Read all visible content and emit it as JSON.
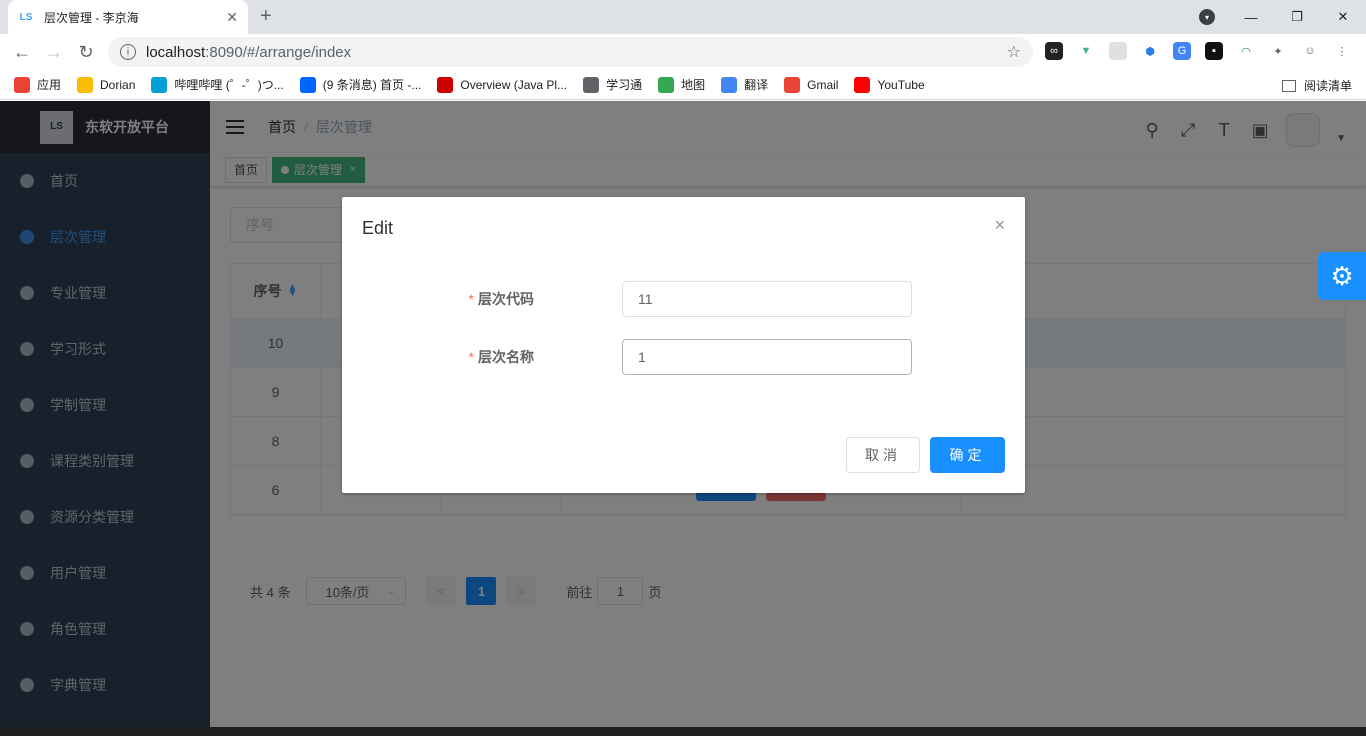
{
  "browser": {
    "tab_title": "层次管理 - 李京海",
    "tab_favicon": "LS",
    "tab_close": "✕",
    "new_tab": "+",
    "url_host": "localhost",
    "url_rest": ":8090/#/arrange/index",
    "bookmarks": [
      {
        "label": "应用",
        "icon_color": "#ea4335"
      },
      {
        "label": "Dorian",
        "icon_color": "#fbbc04"
      },
      {
        "label": "哔哩哔哩 (゜-゜)つ...",
        "icon_color": "#00a1d6"
      },
      {
        "label": "(9 条消息) 首页 -...",
        "icon_color": "#0066ff"
      },
      {
        "label": "Overview (Java Pl...",
        "icon_color": "#c00"
      },
      {
        "label": "学习通",
        "icon_color": "#5f6368"
      },
      {
        "label": "地图",
        "icon_color": "#34a853"
      },
      {
        "label": "翻译",
        "icon_color": "#4285f4"
      },
      {
        "label": "Gmail",
        "icon_color": "#ea4335"
      },
      {
        "label": "YouTube",
        "icon_color": "#ff0000"
      }
    ],
    "reading_list": "阅读清单"
  },
  "app": {
    "brand": "东软开放平台",
    "logo_text": "LS",
    "menu": [
      {
        "label": "首页",
        "icon": "dashboard-icon"
      },
      {
        "label": "层次管理",
        "icon": "globe-icon",
        "active": true
      },
      {
        "label": "专业管理",
        "icon": "globe-icon"
      },
      {
        "label": "学习形式",
        "icon": "globe-icon"
      },
      {
        "label": "学制管理",
        "icon": "globe-icon"
      },
      {
        "label": "课程类别管理",
        "icon": "globe-icon"
      },
      {
        "label": "资源分类管理",
        "icon": "globe-icon"
      },
      {
        "label": "用户管理",
        "icon": "globe-icon"
      },
      {
        "label": "角色管理",
        "icon": "globe-icon"
      },
      {
        "label": "字典管理",
        "icon": "globe-icon"
      }
    ],
    "breadcrumb": {
      "home": "首页",
      "sep": "/",
      "current": "层次管理"
    },
    "tags": {
      "home": "首页",
      "active": "层次管理",
      "close": "×"
    },
    "search_placeholder": "序号",
    "table": {
      "header": "序号",
      "rows": [
        "10",
        "9",
        "8",
        "6"
      ]
    },
    "pagination": {
      "total": "共 4 条",
      "page_size": "10条/页",
      "prev": "<",
      "current_page": "1",
      "next": ">",
      "goto_prefix": "前往",
      "goto_value": "1",
      "goto_suffix": "页"
    }
  },
  "dialog": {
    "title": "Edit",
    "close": "×",
    "fields": [
      {
        "label": "层次代码",
        "value": "11"
      },
      {
        "label": "层次名称",
        "value": "1"
      }
    ],
    "required_mark": "*",
    "cancel": "取消",
    "confirm": "确定"
  },
  "colors": {
    "sidebar_bg": "#304156",
    "primary": "#1890ff",
    "tag_active": "#42b983",
    "danger": "#f56c6c"
  }
}
